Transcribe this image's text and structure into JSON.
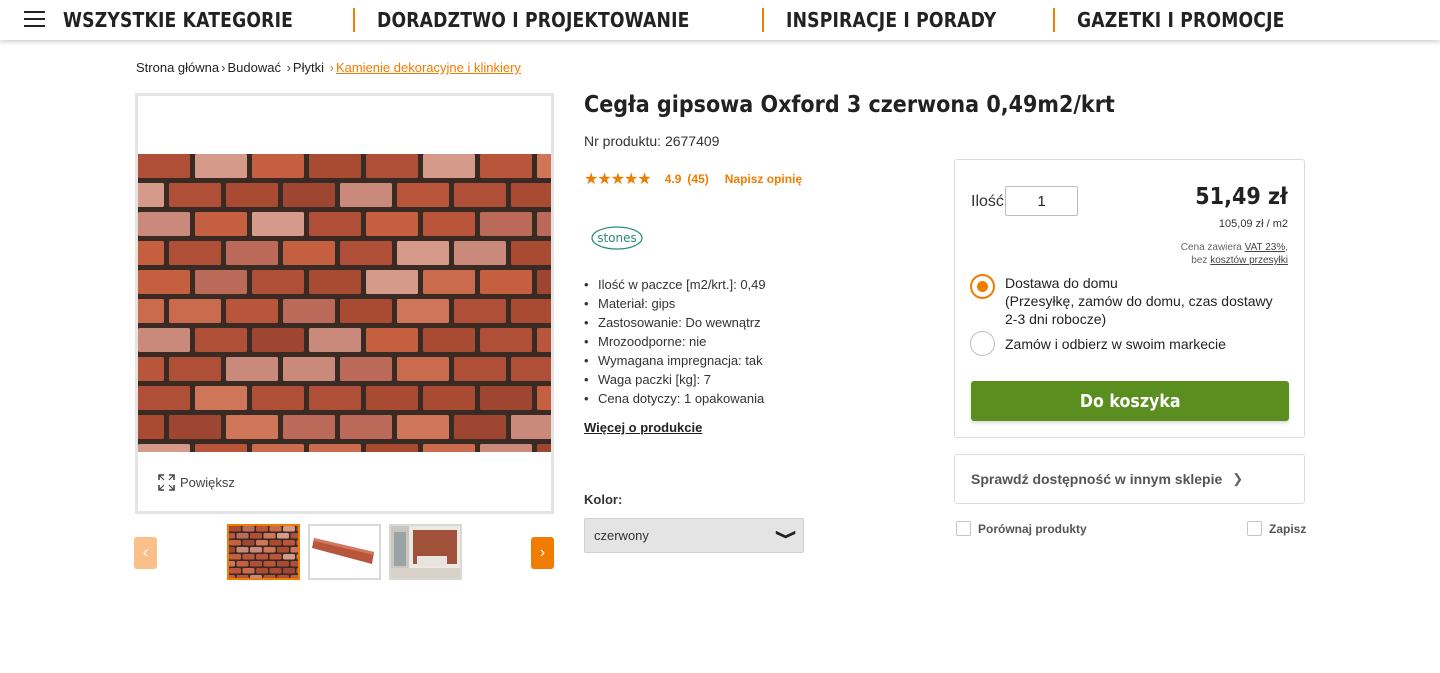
{
  "nav": {
    "items": [
      "WSZYSTKIE KATEGORIE",
      "DORADZTWO I PROJEKTOWANIE",
      "INSPIRACJE I PORADY",
      "GAZETKI I PROMOCJE"
    ]
  },
  "breadcrumb": {
    "items": [
      "Strona główna",
      "Budować",
      "Płytki",
      "Kamienie dekoracyjne i klinkiery"
    ],
    "separator": "›"
  },
  "gallery": {
    "zoom_label": "Powiększ",
    "prev_arrow": "‹",
    "next_arrow": "›",
    "thumbnails": [
      "brick-wall-thumb",
      "single-brick-thumb",
      "interior-room-thumb"
    ],
    "selected_index": 0
  },
  "product": {
    "title": "Cegła gipsowa Oxford 3 czerwona 0,49m2/krt",
    "number_label": "Nr produktu:",
    "number": "2677409",
    "stars": "★★★★★",
    "rating": "4.9",
    "reviews": "(45)",
    "write_review": "Napisz opinię",
    "brand": "stones",
    "features": [
      "Ilość w paczce [m2/krt.]: 0,49",
      "Materiał: gips",
      "Zastosowanie: Do wewnątrz",
      "Mrozoodporne: nie",
      "Wymagana impregnacja: tak",
      "Waga paczki [kg]: 7",
      "Cena dotyczy: 1 opakowania"
    ],
    "more_link": "Więcej o produkcie",
    "color_label": "Kolor:",
    "color_value": "czerwony",
    "color_chevron": "❯"
  },
  "buybox": {
    "qty_label": "Ilość",
    "qty_value": "1",
    "price": "51,49 zł",
    "unit_price": "105,09 zł / m2",
    "vat_prefix": "Cena zawiera ",
    "vat_link": "VAT 23%",
    "vat_suffix": ",",
    "ship_prefix": "bez ",
    "ship_link": "kosztów przesyłki",
    "options": [
      {
        "title": "Dostawa do domu",
        "detail": "(Przesyłkę, zamów do domu, czas dostawy 2-3 dni robocze)",
        "selected": true
      },
      {
        "title": "Zamów i odbierz w swoim markecie",
        "detail": "",
        "selected": false
      }
    ],
    "cart_button": "Do koszyka",
    "availability": "Sprawdź dostępność w innym sklepie",
    "availability_arrow": "❯",
    "compare": "Porównaj produkty",
    "save": "Zapisz"
  },
  "colors": {
    "accent": "#f07c00",
    "cart_green": "#5a8e1e"
  }
}
